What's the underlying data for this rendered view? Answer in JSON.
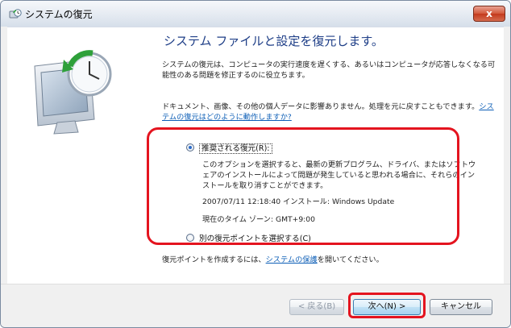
{
  "window": {
    "title": "システムの復元",
    "close_label": "x"
  },
  "main": {
    "heading": "システム ファイルと設定を復元します。",
    "description": "システムの復元は、コンピュータの実行速度を遅くする、あるいはコンピュータが応答しなくなる可能性のある問題を修正するのに役立ちます。",
    "note_text": "ドキュメント、画像、その他の個人データに影響ありません。処理を元に戻すこともできます。",
    "note_link": "システムの復元はどのように動作しますか?",
    "option_recommended": {
      "label": "推奨される復元(R):",
      "selected": true,
      "description": "このオプションを選択すると、最新の更新プログラム、ドライバ、またはソフトウェアのインストールによって問題が発生していると思われる場合に、それらのインストールを取り消すことができます。",
      "install_time": "2007/07/11 12:18:40 インストール: Windows Update",
      "timezone": "現在のタイム ゾーン: GMT+9:00"
    },
    "option_other": {
      "label": "別の復元ポイントを選択する(C)",
      "selected": false
    },
    "footer_prefix": "復元ポイントを作成するには、",
    "footer_link": "システムの保護",
    "footer_suffix": "を開いてください。"
  },
  "buttons": {
    "back": "< 戻る(B)",
    "next": "次へ(N) >",
    "cancel": "キャンセル"
  },
  "colors": {
    "heading": "#1e3e87",
    "link": "#0e5fb7",
    "highlight": "#e4141f"
  }
}
